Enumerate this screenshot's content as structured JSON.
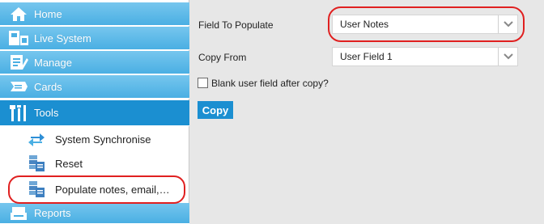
{
  "sidebar": {
    "items": [
      {
        "label": "Home",
        "icon": "home-icon"
      },
      {
        "label": "Live System",
        "icon": "live-system-icon"
      },
      {
        "label": "Manage",
        "icon": "manage-icon"
      },
      {
        "label": "Cards",
        "icon": "cards-icon"
      },
      {
        "label": "Tools",
        "icon": "tools-icon",
        "active": true
      },
      {
        "label": "Reports",
        "icon": "reports-icon"
      }
    ],
    "tools_subitems": [
      {
        "label": "System Synchronise",
        "icon": "sync-arrows-icon"
      },
      {
        "label": "Reset",
        "icon": "server-reset-icon"
      },
      {
        "label": "Populate notes, email,…",
        "icon": "server-populate-icon"
      }
    ]
  },
  "form": {
    "field_to_populate": {
      "label": "Field To Populate",
      "value": "User Notes"
    },
    "copy_from": {
      "label": "Copy From",
      "value": "User Field 1"
    },
    "blank_after_copy": {
      "label": "Blank user field after copy?",
      "checked": false
    },
    "copy_button": "Copy"
  },
  "colors": {
    "nav_gradient_top": "#76c6ee",
    "nav_gradient_bottom": "#4aafe3",
    "active_blue": "#1b8fd1",
    "highlight_red": "#e02020",
    "content_background": "#e7e7e7"
  }
}
